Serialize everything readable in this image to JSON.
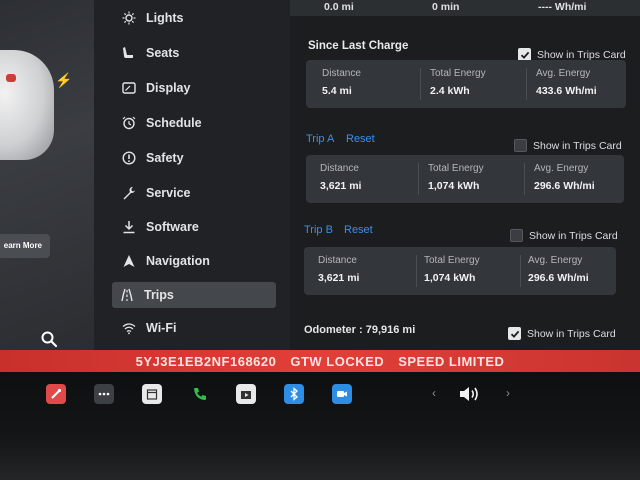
{
  "left": {
    "learn_more_label": "earn More"
  },
  "menu": {
    "items": [
      {
        "label": "Lights",
        "icon": "lights-icon"
      },
      {
        "label": "Seats",
        "icon": "seat-icon"
      },
      {
        "label": "Display",
        "icon": "display-icon"
      },
      {
        "label": "Schedule",
        "icon": "alarm-clock-icon"
      },
      {
        "label": "Safety",
        "icon": "safety-icon"
      },
      {
        "label": "Service",
        "icon": "wrench-icon"
      },
      {
        "label": "Software",
        "icon": "download-icon"
      },
      {
        "label": "Navigation",
        "icon": "navigation-arrow-icon"
      },
      {
        "label": "Trips",
        "icon": "trips-icon",
        "active": true
      },
      {
        "label": "Wi-Fi",
        "icon": "wifi-icon"
      }
    ]
  },
  "top_partial": {
    "distance": "0.0 mi",
    "time": "0 min",
    "energy": "---- Wh/mi"
  },
  "since_last_charge": {
    "title": "Since Last Charge",
    "show_label": "Show in Trips Card",
    "show_checked": true,
    "distance_label": "Distance",
    "distance_value": "5.4 mi",
    "energy_label": "Total Energy",
    "energy_value": "2.4 kWh",
    "avg_label": "Avg. Energy",
    "avg_value": "433.6 Wh/mi"
  },
  "trip_a": {
    "label": "Trip A",
    "reset_label": "Reset",
    "show_label": "Show in Trips Card",
    "show_checked": false,
    "distance_label": "Distance",
    "distance_value": "3,621 mi",
    "energy_label": "Total Energy",
    "energy_value": "1,074 kWh",
    "avg_label": "Avg. Energy",
    "avg_value": "296.6 Wh/mi"
  },
  "trip_b": {
    "label": "Trip B",
    "reset_label": "Reset",
    "show_label": "Show in Trips Card",
    "show_checked": false,
    "distance_label": "Distance",
    "distance_value": "3,621 mi",
    "energy_label": "Total Energy",
    "energy_value": "1,074 kWh",
    "avg_label": "Avg. Energy",
    "avg_value": "296.6 Wh/mi"
  },
  "odometer": {
    "text": "Odometer : 79,916 mi",
    "show_label": "Show in Trips Card",
    "show_checked": true
  },
  "status_bar": {
    "vin": "5YJ3E1EB2NF168620",
    "gateway": "GTW LOCKED",
    "speed": "SPEED LIMITED"
  },
  "dock": {
    "prev_glyph": "‹",
    "next_glyph": "›",
    "apps": [
      {
        "name": "toybox",
        "icon": "toybox-icon",
        "color": "#e04a4a"
      },
      {
        "name": "more",
        "icon": "ellipsis-icon",
        "color": "#3c3f43"
      },
      {
        "name": "calendar",
        "icon": "calendar-icon",
        "color": "#e9e9e9"
      },
      {
        "name": "phone",
        "icon": "phone-icon",
        "color": "#2fbf4a"
      },
      {
        "name": "media",
        "icon": "media-icon",
        "color": "#e9e9e9"
      },
      {
        "name": "bluetooth",
        "icon": "bluetooth-icon",
        "color": "#2e8ee6"
      },
      {
        "name": "camera",
        "icon": "camera-icon",
        "color": "#2e8ee6"
      }
    ]
  }
}
